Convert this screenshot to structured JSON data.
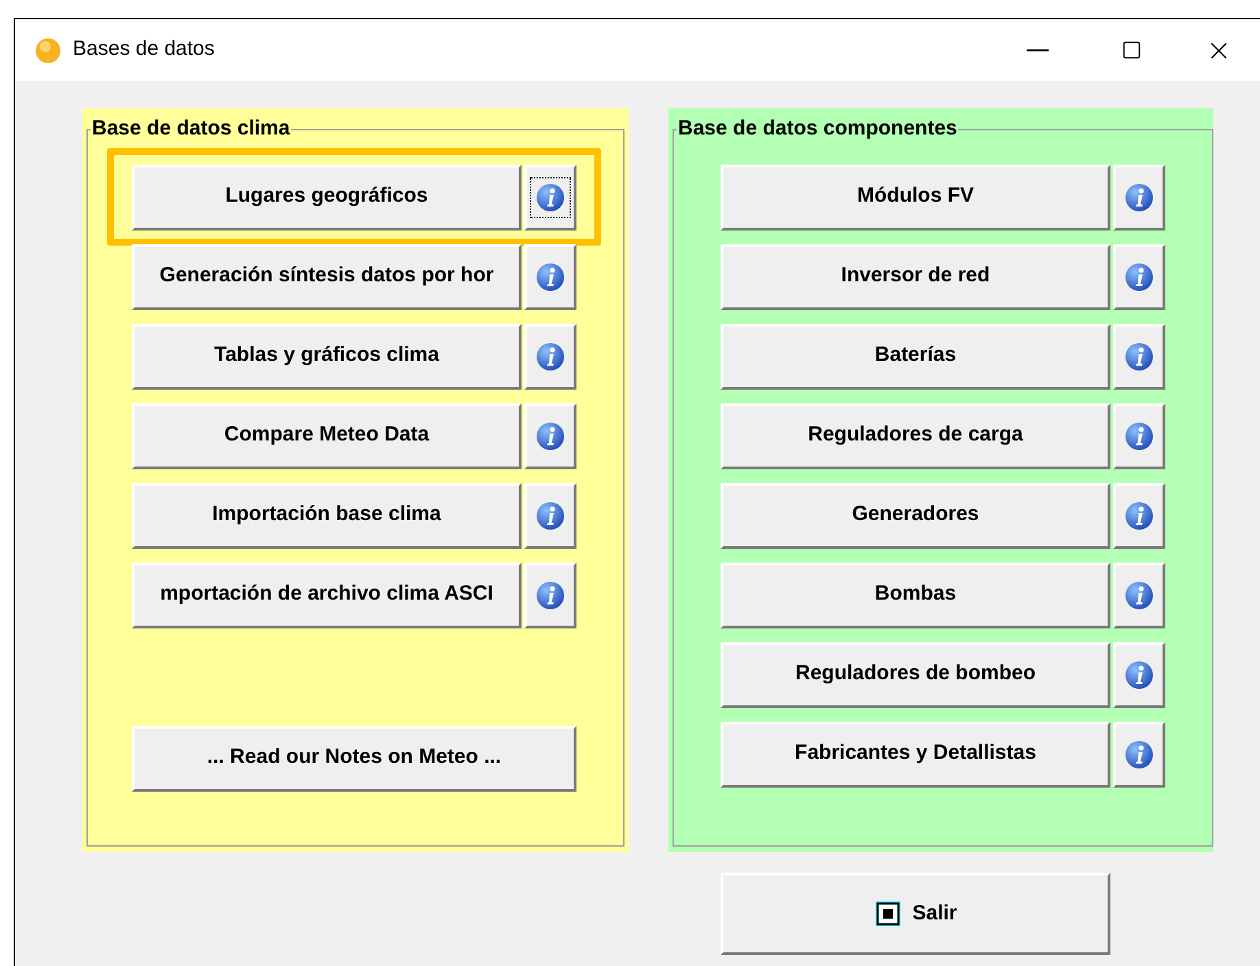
{
  "window": {
    "title": "Bases de datos"
  },
  "climate": {
    "legend": "Base de datos clima",
    "items": [
      {
        "label": "Lugares geográficos",
        "highlighted": true,
        "focused": true
      },
      {
        "label": "Generación síntesis datos por hor",
        "highlighted": false,
        "focused": false
      },
      {
        "label": "Tablas y gráficos clima",
        "highlighted": false,
        "focused": false
      },
      {
        "label": "Compare Meteo Data",
        "highlighted": false,
        "focused": false
      },
      {
        "label": "Importación base clima",
        "highlighted": false,
        "focused": false
      },
      {
        "label": "mportación de archivo clima ASCI",
        "highlighted": false,
        "focused": false
      }
    ],
    "notes_button": "... Read our Notes on Meteo ..."
  },
  "components": {
    "legend": "Base de datos componentes",
    "items": [
      {
        "label": "Módulos FV"
      },
      {
        "label": "Inversor de red"
      },
      {
        "label": "Baterías"
      },
      {
        "label": "Reguladores de carga"
      },
      {
        "label": "Generadores"
      },
      {
        "label": "Bombas"
      },
      {
        "label": "Reguladores de bombeo"
      },
      {
        "label": "Fabricantes y Detallistas"
      }
    ]
  },
  "exit_button": "Salir"
}
